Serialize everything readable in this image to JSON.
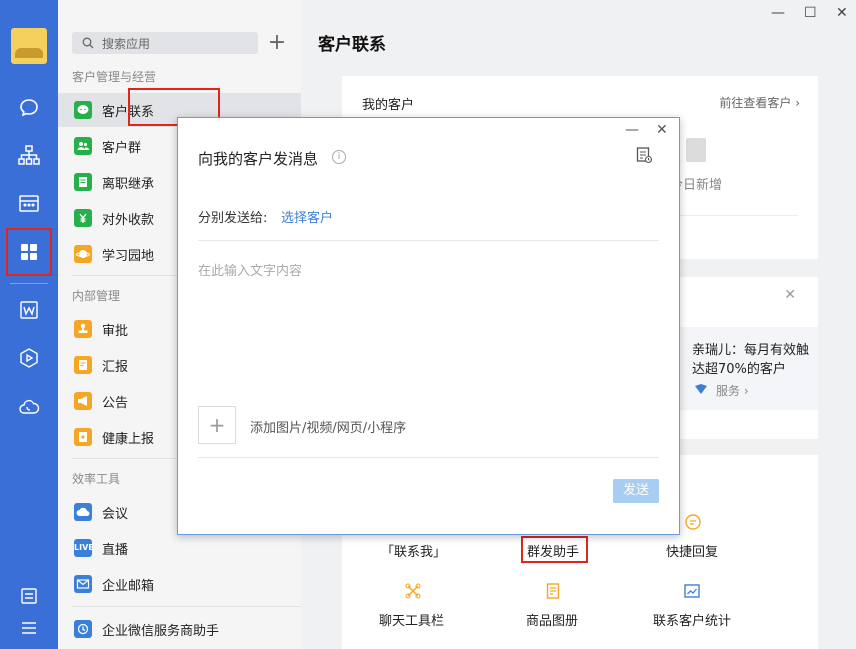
{
  "search": {
    "placeholder": "搜索应用"
  },
  "sections": {
    "customer": "客户管理与经营",
    "internal": "内部管理",
    "efficiency": "效率工具"
  },
  "apps": {
    "contacts": "客户联系",
    "groups": "客户群",
    "resign": "离职继承",
    "payment": "对外收款",
    "learning": "学习园地",
    "approval": "审批",
    "report": "汇报",
    "notice": "公告",
    "health": "健康上报",
    "meeting": "会议",
    "live": "直播",
    "mail": "企业邮箱",
    "helper": "企业微信服务商助手"
  },
  "icon_text": {
    "live": "LIVE"
  },
  "main": {
    "title": "客户联系",
    "my_customers": "我的客户",
    "go_view": "前往查看客户",
    "today_new": "今日新增",
    "promo_text": "亲瑞儿：每月有效触达超70%的客户",
    "service": "服务 ›"
  },
  "tools": {
    "contact_me": "「联系我」",
    "mass_send": "群发助手",
    "quick_reply": "快捷回复",
    "chat_toolbar": "聊天工具栏",
    "catalog": "商品图册",
    "stats": "联系客户统计"
  },
  "dialog": {
    "title": "向我的客户发消息",
    "send_to_label": "分别发送给:",
    "choose_customers": "选择客户",
    "input_placeholder": "在此输入文字内容",
    "attach_label": "添加图片/视频/网页/小程序",
    "send_button": "发送"
  },
  "colors": {
    "rail": "#3a6fd8",
    "highlight": "#e1251b",
    "link": "#3d7fd6",
    "send_disabled": "#a8cdf3"
  }
}
